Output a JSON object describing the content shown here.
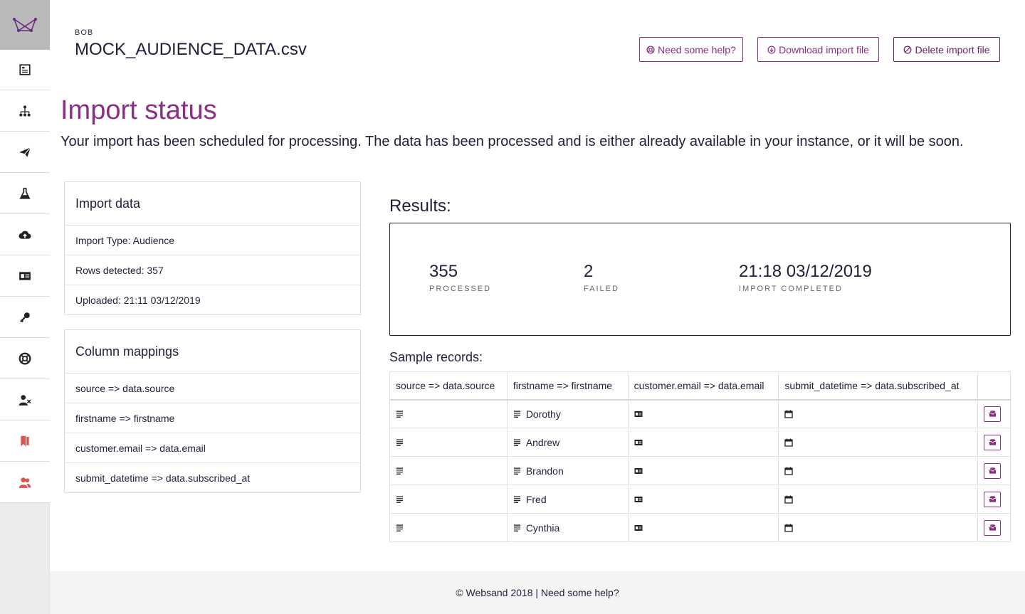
{
  "colors": {
    "accent": "#8c2d86",
    "text": "#1f1f3a",
    "sidebar_bg": "#ececec",
    "danger_icon": "#d9534f"
  },
  "sidebar": {
    "items": [
      {
        "icon": "dashboard-icon"
      },
      {
        "icon": "hierarchy-icon"
      },
      {
        "icon": "paper-plane-icon"
      },
      {
        "icon": "flask-icon"
      },
      {
        "icon": "cloud-upload-icon"
      },
      {
        "icon": "id-card-icon"
      },
      {
        "icon": "key-icon"
      },
      {
        "icon": "life-ring-icon"
      },
      {
        "icon": "user-remove-icon"
      },
      {
        "icon": "bookmark-icon"
      },
      {
        "icon": "users-icon"
      }
    ]
  },
  "header": {
    "account": "BOB",
    "file_name": "MOCK_AUDIENCE_DATA.csv",
    "help_label": "Need some help?",
    "download_label": "Download import file",
    "delete_label": "Delete import file"
  },
  "page": {
    "title": "Import status",
    "intro": "Your import has been scheduled for processing. The data has been processed and is either already available in your instance, or it will be soon."
  },
  "import_data": {
    "title": "Import data",
    "rows": [
      "Import Type: Audience",
      "Rows detected: 357",
      "Uploaded: 21:11 03/12/2019"
    ]
  },
  "column_mappings": {
    "title": "Column mappings",
    "rows": [
      "source => data.source",
      "firstname => firstname",
      "customer.email => data.email",
      "submit_datetime => data.subscribed_at"
    ]
  },
  "results": {
    "label": "Results:",
    "processed_value": "355",
    "processed_label": "PROCESSED",
    "failed_value": "2",
    "failed_label": "FAILED",
    "completed_value": "21:18 03/12/2019",
    "completed_label": "IMPORT COMPLETED"
  },
  "sample": {
    "label": "Sample records:",
    "headers": [
      "source => data.source",
      "firstname => firstname",
      "customer.email => data.email",
      "submit_datetime => data.subscribed_at",
      ""
    ],
    "rows": [
      {
        "firstname": "Dorothy"
      },
      {
        "firstname": "Andrew"
      },
      {
        "firstname": "Brandon"
      },
      {
        "firstname": "Fred"
      },
      {
        "firstname": "Cynthia"
      }
    ]
  },
  "footer": {
    "text": "© Websand 2018 | Need some help?"
  }
}
